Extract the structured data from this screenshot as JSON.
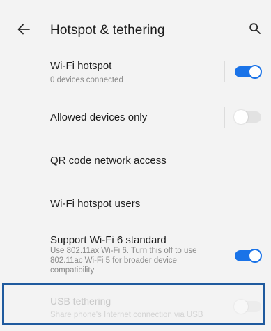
{
  "header": {
    "title": "Hotspot & tethering",
    "back_icon": "arrow-back-icon",
    "search_icon": "search-icon"
  },
  "settings": {
    "wifi_hotspot": {
      "title": "Wi-Fi hotspot",
      "subtitle": "0 devices connected",
      "enabled": true
    },
    "allowed_devices": {
      "title": "Allowed devices only",
      "enabled": false
    },
    "qr_code": {
      "title": "QR code network access"
    },
    "hotspot_users": {
      "title": "Wi-Fi hotspot users"
    },
    "wifi6": {
      "title": "Support Wi-Fi 6 standard",
      "subtitle": "Use 802.11ax Wi-Fi 6. Turn this off to use 802.11ac Wi-Fi 5 for broader device compatibility",
      "enabled": true
    },
    "usb_tethering": {
      "title": "USB tethering",
      "subtitle": "Share phone's Internet connection via USB",
      "enabled": false,
      "disabled": true
    }
  },
  "colors": {
    "accent": "#1a73e8",
    "highlight": "#1f5a9e",
    "background": "#f3f3f3"
  }
}
